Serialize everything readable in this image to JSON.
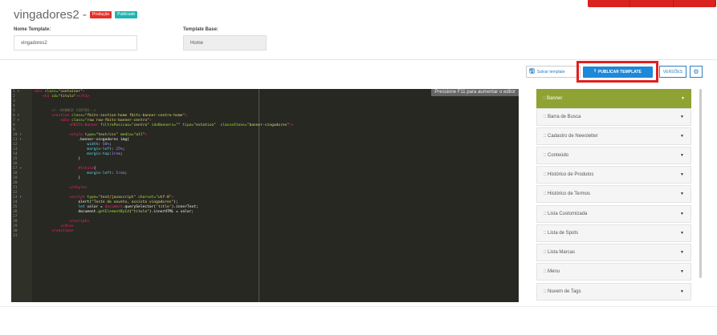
{
  "header": {
    "title": "vingadores2 -",
    "badges": [
      {
        "label": "Produção",
        "color": "#e5302a"
      },
      {
        "label": "Publicado",
        "color": "#1fb3b0"
      }
    ]
  },
  "form": {
    "name_label": "Nome Template:",
    "name_value": "vingadores2",
    "base_label": "Template Base:",
    "base_value": "Home"
  },
  "toolbar": {
    "save_label": "Salvar template",
    "publish_label": "PUBLICAR TEMPLATE",
    "versions_label": "VERSÕES",
    "gear_icon": "gear-icon",
    "save_icon": "floppy-disk-icon",
    "publish_icon": "upload-icon"
  },
  "editor": {
    "hint": "Pressione F11 para aumentar o editor",
    "theme_bg": "#272822"
  },
  "sidebar": {
    "active_color": "#8fa234",
    "items": [
      {
        "label": ":: Banner"
      },
      {
        "label": ":: Barra de Busca"
      },
      {
        "label": ":: Cadastro de Newsletter"
      },
      {
        "label": ":: Conteúdo"
      },
      {
        "label": ":: Histórico de Produtos"
      },
      {
        "label": ":: Histórico de Termos"
      },
      {
        "label": ":: Lista Customizada"
      },
      {
        "label": ":: Lista de Spots"
      },
      {
        "label": ":: Lista Marcas"
      },
      {
        "label": ":: Menu"
      },
      {
        "label": ":: Nuvem de Tags"
      }
    ]
  }
}
